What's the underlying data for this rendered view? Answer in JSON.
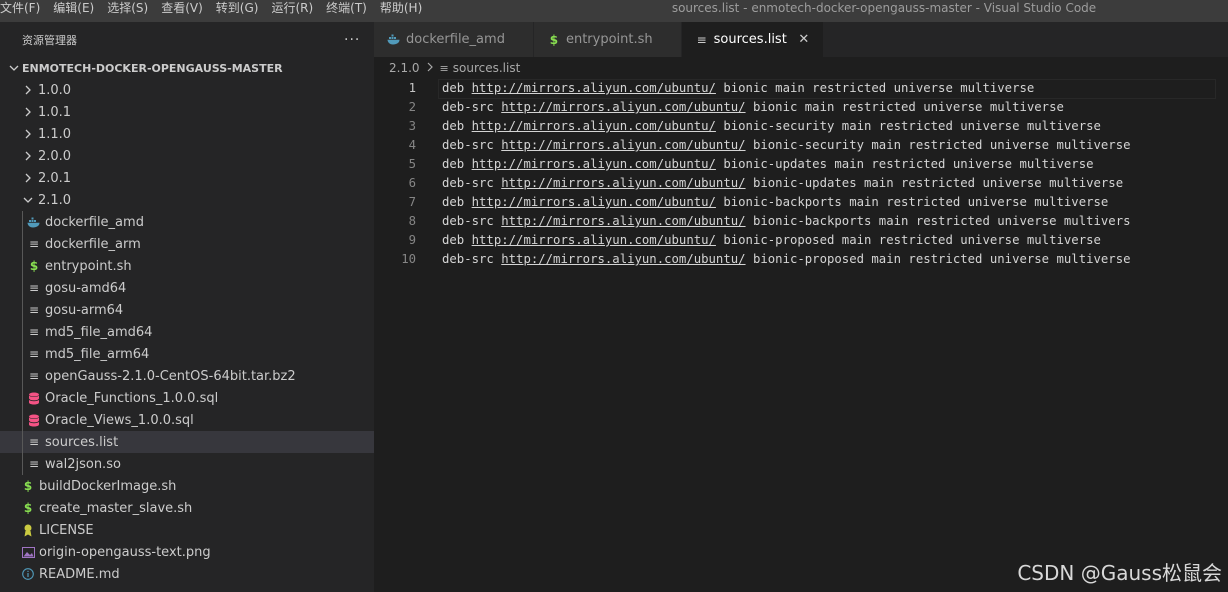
{
  "titlebar": {
    "menu": [
      "文件(F)",
      "编辑(E)",
      "选择(S)",
      "查看(V)",
      "转到(G)",
      "运行(R)",
      "终端(T)",
      "帮助(H)"
    ],
    "window_title": "sources.list - enmotech-docker-opengauss-master - Visual Studio Code"
  },
  "sidebar": {
    "title": "资源管理器",
    "more_icon": "ellipsis-icon",
    "section": "ENMOTECH-DOCKER-OPENGAUSS-MASTER",
    "items": [
      {
        "label": "1.0.0",
        "type": "folder",
        "expanded": false,
        "depth": 0
      },
      {
        "label": "1.0.1",
        "type": "folder",
        "expanded": false,
        "depth": 0
      },
      {
        "label": "1.1.0",
        "type": "folder",
        "expanded": false,
        "depth": 0
      },
      {
        "label": "2.0.0",
        "type": "folder",
        "expanded": false,
        "depth": 0
      },
      {
        "label": "2.0.1",
        "type": "folder",
        "expanded": false,
        "depth": 0
      },
      {
        "label": "2.1.0",
        "type": "folder",
        "expanded": true,
        "depth": 0
      },
      {
        "label": "dockerfile_amd",
        "type": "docker",
        "depth": 1
      },
      {
        "label": "dockerfile_arm",
        "type": "text",
        "depth": 1
      },
      {
        "label": "entrypoint.sh",
        "type": "shell",
        "depth": 1
      },
      {
        "label": "gosu-amd64",
        "type": "text",
        "depth": 1
      },
      {
        "label": "gosu-arm64",
        "type": "text",
        "depth": 1
      },
      {
        "label": "md5_file_amd64",
        "type": "text",
        "depth": 1
      },
      {
        "label": "md5_file_arm64",
        "type": "text",
        "depth": 1
      },
      {
        "label": "openGauss-2.1.0-CentOS-64bit.tar.bz2",
        "type": "text",
        "depth": 1
      },
      {
        "label": "Oracle_Functions_1.0.0.sql",
        "type": "database",
        "depth": 1
      },
      {
        "label": "Oracle_Views_1.0.0.sql",
        "type": "database",
        "depth": 1
      },
      {
        "label": "sources.list",
        "type": "text",
        "depth": 1,
        "selected": true
      },
      {
        "label": "wal2json.so",
        "type": "text",
        "depth": 1
      },
      {
        "label": "buildDockerImage.sh",
        "type": "shell",
        "depth": 0
      },
      {
        "label": "create_master_slave.sh",
        "type": "shell",
        "depth": 0
      },
      {
        "label": "LICENSE",
        "type": "license",
        "depth": 0
      },
      {
        "label": "origin-opengauss-text.png",
        "type": "image",
        "depth": 0
      },
      {
        "label": "README.md",
        "type": "info",
        "depth": 0
      }
    ]
  },
  "tabs": [
    {
      "label": "dockerfile_amd",
      "icon": "docker-icon",
      "active": false
    },
    {
      "label": "entrypoint.sh",
      "icon": "shell-icon",
      "active": false
    },
    {
      "label": "sources.list",
      "icon": "text-file-icon",
      "active": true
    }
  ],
  "breadcrumb": {
    "folder": "2.1.0",
    "file": "sources.list"
  },
  "editor": {
    "lines": [
      {
        "n": "1",
        "pre": "deb ",
        "url": "http://mirrors.aliyun.com/ubuntu/",
        "post": " bionic main restricted universe multiverse"
      },
      {
        "n": "2",
        "pre": "deb-src ",
        "url": "http://mirrors.aliyun.com/ubuntu/",
        "post": " bionic main restricted universe multiverse"
      },
      {
        "n": "3",
        "pre": "deb ",
        "url": "http://mirrors.aliyun.com/ubuntu/",
        "post": " bionic-security main restricted universe multiverse"
      },
      {
        "n": "4",
        "pre": "deb-src ",
        "url": "http://mirrors.aliyun.com/ubuntu/",
        "post": " bionic-security main restricted universe multiverse"
      },
      {
        "n": "5",
        "pre": "deb ",
        "url": "http://mirrors.aliyun.com/ubuntu/",
        "post": " bionic-updates main restricted universe multiverse"
      },
      {
        "n": "6",
        "pre": "deb-src ",
        "url": "http://mirrors.aliyun.com/ubuntu/",
        "post": " bionic-updates main restricted universe multiverse"
      },
      {
        "n": "7",
        "pre": "deb ",
        "url": "http://mirrors.aliyun.com/ubuntu/",
        "post": " bionic-backports main restricted universe multiverse"
      },
      {
        "n": "8",
        "pre": "deb-src ",
        "url": "http://mirrors.aliyun.com/ubuntu/",
        "post": " bionic-backports main restricted universe multivers"
      },
      {
        "n": "9",
        "pre": "deb ",
        "url": "http://mirrors.aliyun.com/ubuntu/",
        "post": " bionic-proposed main restricted universe multiverse"
      },
      {
        "n": "10",
        "pre": "deb-src ",
        "url": "http://mirrors.aliyun.com/ubuntu/",
        "post": " bionic-proposed main restricted universe multiverse"
      }
    ]
  },
  "watermark": "CSDN @Gauss松鼠会",
  "colors": {
    "docker": "#519aba",
    "shell": "#89e051",
    "database": "#f55385",
    "license": "#cbcb41",
    "image": "#a074c4",
    "info": "#519aba",
    "text": "#cccccc"
  }
}
